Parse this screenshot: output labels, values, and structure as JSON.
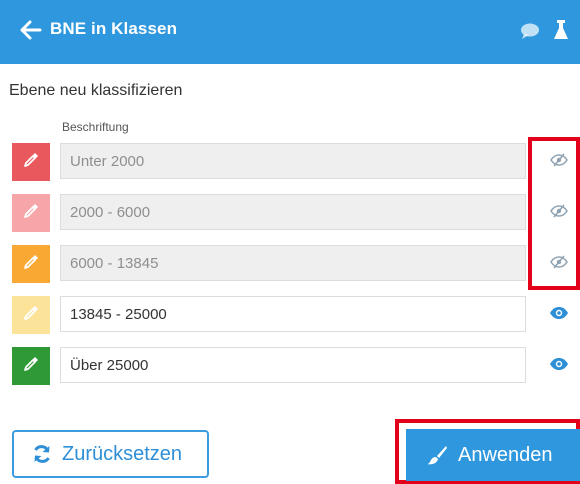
{
  "header": {
    "title": "BNE in Klassen"
  },
  "panel": {
    "title": "Ebene neu klassifizieren",
    "column_header": "Beschriftung"
  },
  "classes": [
    {
      "label": "Unter 2000",
      "color": "#e8585d",
      "visible": false
    },
    {
      "label": "2000 - 6000",
      "color": "#f6a6a8",
      "visible": false
    },
    {
      "label": "6000 - 13845",
      "color": "#f9a833",
      "visible": false
    },
    {
      "label": "13845 - 25000",
      "color": "#fbe39a",
      "visible": true
    },
    {
      "label": "Über 25000",
      "color": "#2f9a35",
      "visible": true
    }
  ],
  "buttons": {
    "reset_label": "Zurücksetzen",
    "apply_label": "Anwenden"
  },
  "colors": {
    "brand": "#2e97dd",
    "highlight": "#e2001a"
  }
}
